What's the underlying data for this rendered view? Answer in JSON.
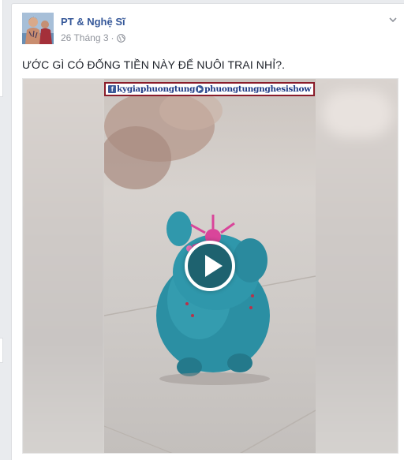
{
  "post": {
    "author": "PT & Nghệ Sĩ",
    "date": "26 Tháng 3",
    "separator": "·",
    "privacy_icon": "globe-icon",
    "options_icon": "chevron-down-icon",
    "text": "ƯỚC GÌ CÓ ĐỐNG TIỀN NÀY ĐỂ NUÔI TRAI NHỈ?."
  },
  "video": {
    "watermark_part1": "kygiaphuongtung",
    "watermark_part2": "phuongtungnghesishow",
    "play_icon": "play-icon"
  },
  "colors": {
    "author_link": "#365899",
    "meta_text": "#90949c",
    "piggy_bank": "#2b8fa3",
    "watermark_border": "#8a1c2a"
  }
}
